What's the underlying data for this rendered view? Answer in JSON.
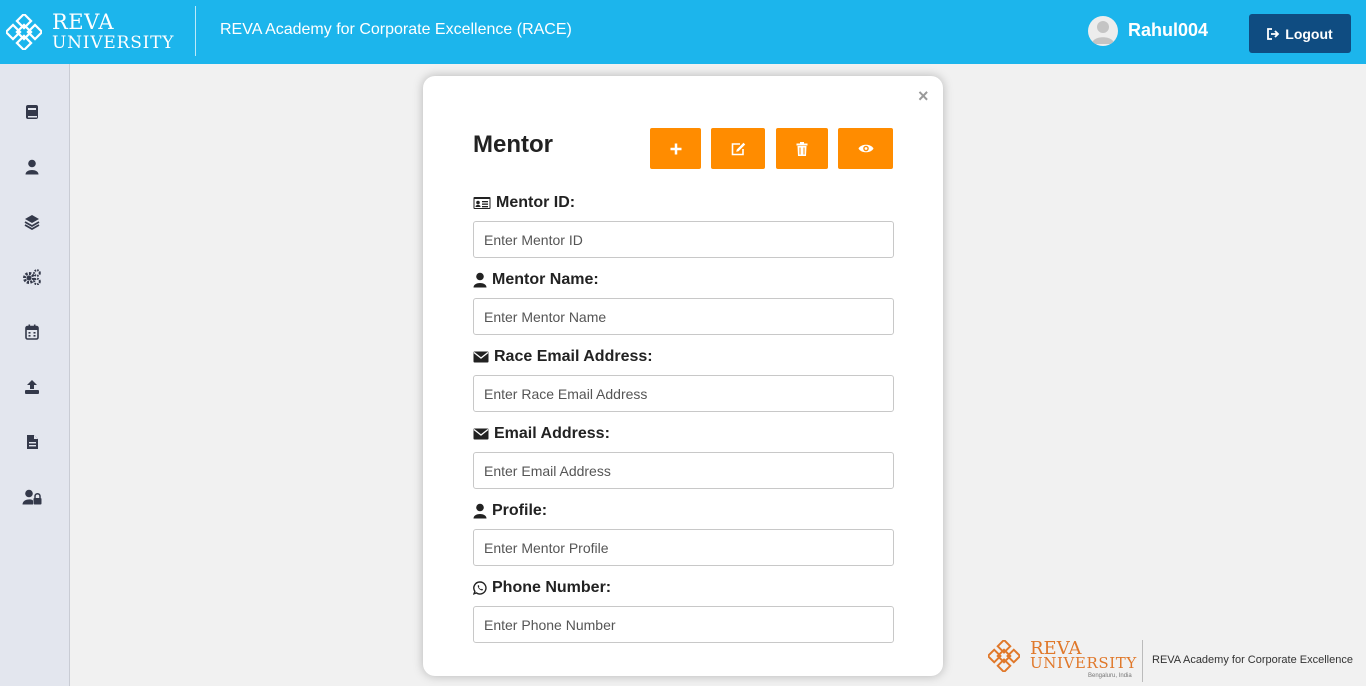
{
  "header": {
    "logo_line1": "REVA",
    "logo_line2": "UNIVERSITY",
    "title": "REVA Academy for Corporate Excellence (RACE)",
    "username": "Rahul004",
    "logout_label": "Logout",
    "background_color": "#1cb5ec"
  },
  "sidebar": {
    "items": [
      {
        "icon": "book-icon"
      },
      {
        "icon": "user-icon"
      },
      {
        "icon": "layers-icon"
      },
      {
        "icon": "cogs-icon"
      },
      {
        "icon": "calendar-icon"
      },
      {
        "icon": "upload-icon"
      },
      {
        "icon": "file-icon"
      },
      {
        "icon": "user-lock-icon"
      }
    ]
  },
  "modal": {
    "close_label": "×",
    "title": "Mentor",
    "actions": [
      {
        "icon": "plus-icon",
        "color": "#ff8c00"
      },
      {
        "icon": "edit-icon",
        "color": "#ff8c00"
      },
      {
        "icon": "trash-icon",
        "color": "#ff8c00"
      },
      {
        "icon": "eye-icon",
        "color": "#ff8c00"
      }
    ],
    "fields": [
      {
        "label": "Mentor ID:",
        "icon": "id-card-icon",
        "placeholder": "Enter Mentor ID",
        "value": ""
      },
      {
        "label": "Mentor Name:",
        "icon": "user-icon",
        "placeholder": "Enter Mentor Name",
        "value": ""
      },
      {
        "label": "Race Email Address:",
        "icon": "envelope-icon",
        "placeholder": "Enter Race Email Address",
        "value": ""
      },
      {
        "label": "Email Address:",
        "icon": "envelope-icon",
        "placeholder": "Enter Email Address",
        "value": ""
      },
      {
        "label": "Profile:",
        "icon": "user-icon",
        "placeholder": "Enter Mentor Profile",
        "value": ""
      },
      {
        "label": "Phone Number:",
        "icon": "whatsapp-icon",
        "placeholder": "Enter Phone Number",
        "value": ""
      }
    ]
  },
  "footer": {
    "logo_line1": "REVA",
    "logo_line2": "UNIVERSITY",
    "logo_location": "Bengaluru, India",
    "tagline": "REVA Academy for Corporate Excellence",
    "accent_color": "#e0782a"
  }
}
